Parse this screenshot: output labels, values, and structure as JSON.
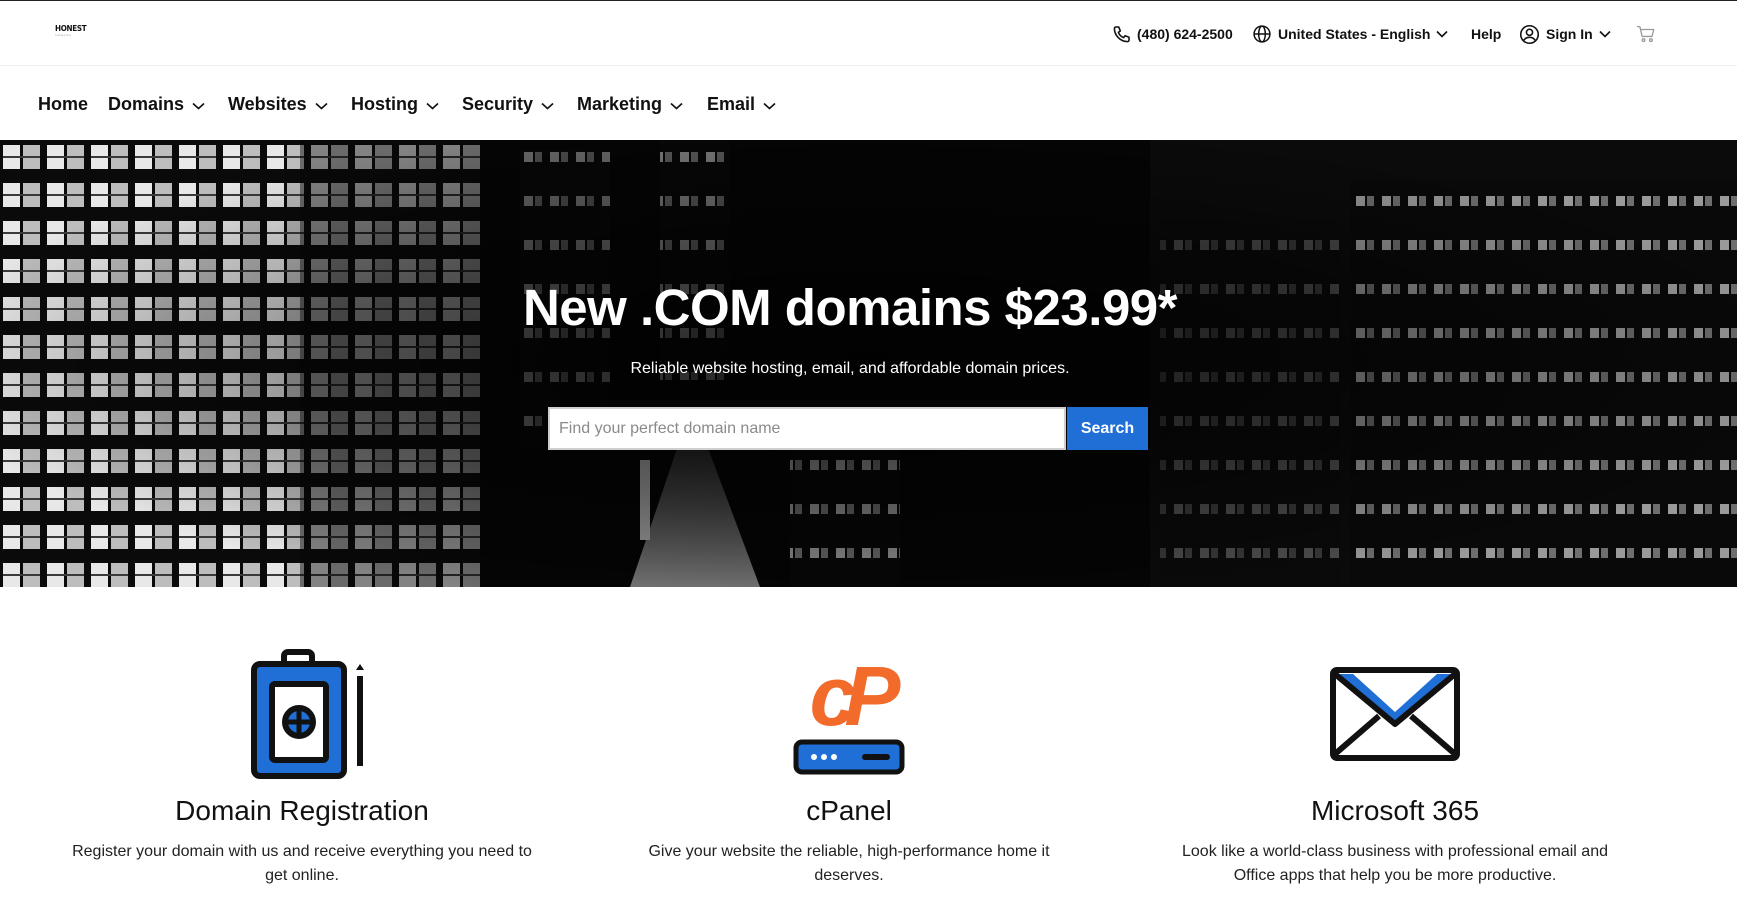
{
  "brand": {
    "logo_text": "HONEST",
    "logo_sub": "networks"
  },
  "utility": {
    "phone": "(480) 624-2500",
    "locale": "United States - English",
    "help": "Help",
    "sign_in": "Sign In"
  },
  "nav": {
    "items": [
      {
        "label": "Home"
      },
      {
        "label": "Domains"
      },
      {
        "label": "Websites"
      },
      {
        "label": "Hosting"
      },
      {
        "label": "Security"
      },
      {
        "label": "Marketing"
      },
      {
        "label": "Email"
      }
    ]
  },
  "hero": {
    "title": "New .COM domains $23.99*",
    "subtitle": "Reliable website hosting, email, and affordable domain prices.",
    "search_placeholder": "Find your perfect domain name",
    "search_value": "",
    "search_button": "Search"
  },
  "features": [
    {
      "title": "Domain Registration",
      "description": "Register your domain with us and receive everything you need to get online.",
      "icon": "domain-registration-icon"
    },
    {
      "title": "cPanel",
      "description": "Give your website the reliable, high-performance home it deserves.",
      "icon": "cpanel-icon"
    },
    {
      "title": "Microsoft 365",
      "description": "Look like a world-class business with professional email and Office apps that help you be more productive.",
      "icon": "envelope-icon"
    }
  ],
  "colors": {
    "accent": "#1f6fd6",
    "cpanel_orange": "#f26b2a",
    "hero_bg": "#050505",
    "text": "#111111"
  }
}
